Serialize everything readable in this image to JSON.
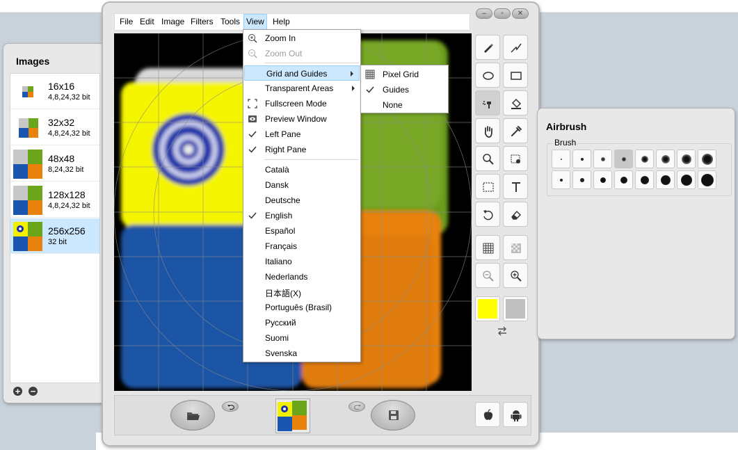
{
  "menubar": {
    "items": [
      "File",
      "Edit",
      "Image",
      "Filters",
      "Tools",
      "View",
      "Help"
    ]
  },
  "images_panel": {
    "title": "Images",
    "items": [
      {
        "size": "16x16",
        "bits": "4,8,24,32 bit"
      },
      {
        "size": "32x32",
        "bits": "4,8,24,32 bit"
      },
      {
        "size": "48x48",
        "bits": "8,24,32 bit"
      },
      {
        "size": "128x128",
        "bits": "4,8,24,32 bit"
      },
      {
        "size": "256x256",
        "bits": "32 bit"
      }
    ],
    "add_label": "+",
    "remove_label": "−"
  },
  "view_menu": {
    "zoom_in": "Zoom In",
    "zoom_out": "Zoom Out",
    "grid_and_guides": "Grid and Guides",
    "transparent_areas": "Transparent Areas",
    "fullscreen_mode": "Fullscreen Mode",
    "preview_window": "Preview Window",
    "left_pane": "Left Pane",
    "right_pane": "Right Pane",
    "languages": [
      "Català",
      "Dansk",
      "Deutsche",
      "English",
      "Español",
      "Français",
      "Italiano",
      "Nederlands",
      "日本語(X)",
      "Português (Brasil)",
      "Русский",
      "Suomi",
      "Svenska"
    ]
  },
  "grid_submenu": {
    "pixel_grid": "Pixel Grid",
    "guides": "Guides",
    "none": "None"
  },
  "airbrush_panel": {
    "title": "Airbrush",
    "brush_label": "Brush"
  },
  "colors": {
    "primary": "#ffff00",
    "secondary": "#c0c0c0",
    "accent_highlight": "#cce8ff"
  },
  "tools": [
    "pencil-icon",
    "line-icon",
    "ellipse-icon",
    "rectangle-icon",
    "airbrush-icon",
    "fill-icon",
    "hand-icon",
    "eyedropper-icon",
    "zoom-icon",
    "select-image-icon",
    "selection-icon",
    "text-icon",
    "rotate-icon",
    "eraser-icon",
    "grid-icon",
    "checker-icon",
    "zoom-out-icon",
    "zoom-in-icon",
    "swap-colors-icon",
    "apple-icon",
    "android-icon"
  ]
}
